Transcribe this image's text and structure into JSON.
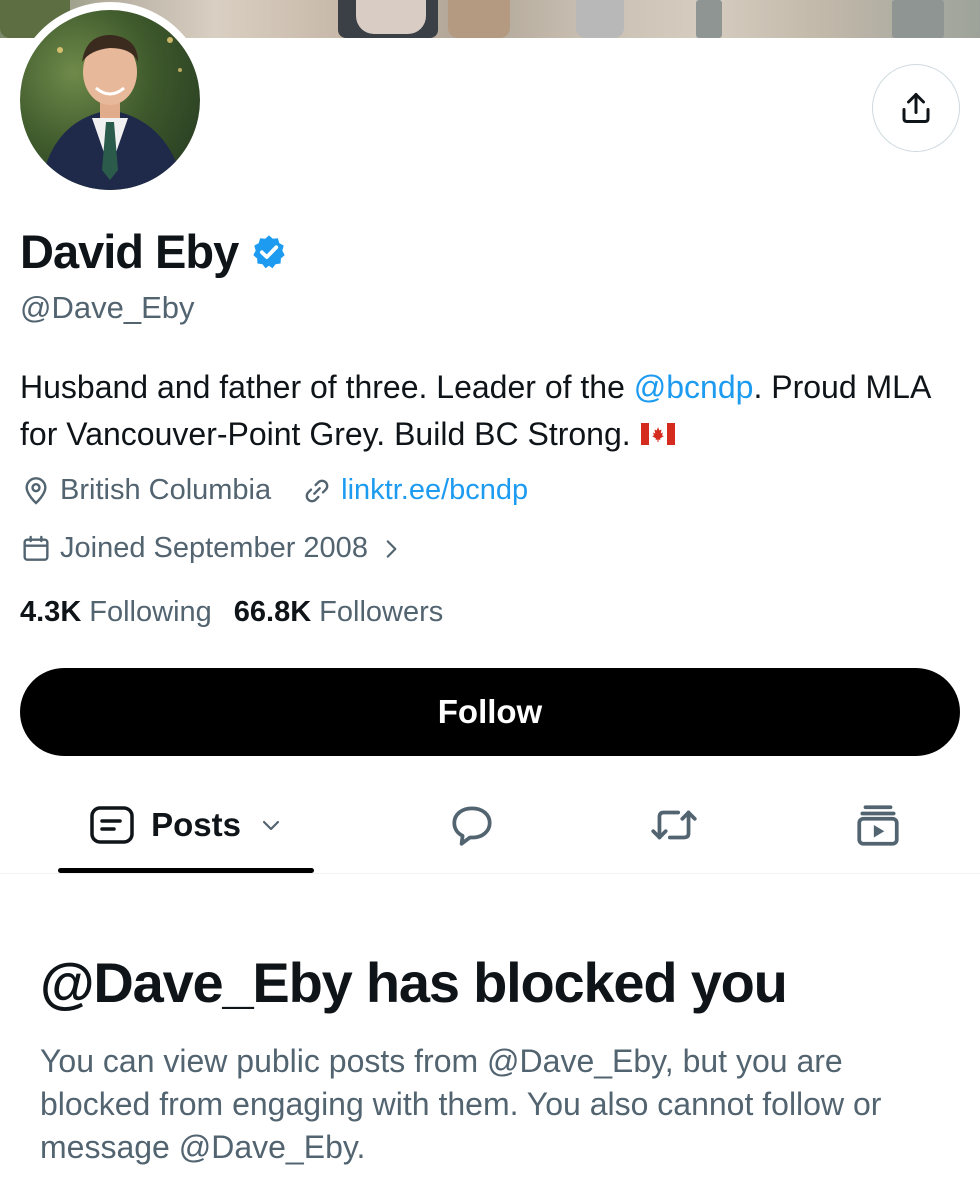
{
  "profile": {
    "name": "David Eby",
    "handle": "@Dave_Eby",
    "verified": true,
    "bio_part1": "Husband and father of three. Leader of the ",
    "bio_mention": "@bcndp",
    "bio_part2": ". Proud MLA for Vancouver-Point Grey. Build BC Strong.",
    "location": "British Columbia",
    "website": "linktr.ee/bcndp",
    "joined": "Joined September 2008"
  },
  "stats": {
    "following_count": "4.3K",
    "following_label": "Following",
    "followers_count": "66.8K",
    "followers_label": "Followers"
  },
  "actions": {
    "follow_label": "Follow"
  },
  "tabs": {
    "posts_label": "Posts"
  },
  "blocked": {
    "title": "@Dave_Eby has blocked you",
    "message": "You can view public posts from @Dave_Eby, but you are blocked from engaging with them. You also cannot follow or message @Dave_Eby."
  },
  "icons": {
    "share": "share-icon",
    "verified": "verified-badge-icon",
    "location": "location-pin-icon",
    "link": "link-icon",
    "calendar": "calendar-icon",
    "chevron": "chevron-right-icon",
    "posts": "posts-icon",
    "replies": "reply-bubble-icon",
    "reposts": "repost-icon",
    "media": "media-icon",
    "flag": "canada-flag-icon"
  },
  "colors": {
    "accent": "#1d9bf0",
    "secondary_text": "#536471",
    "primary_text": "#0f1419",
    "button_bg": "#000000"
  }
}
